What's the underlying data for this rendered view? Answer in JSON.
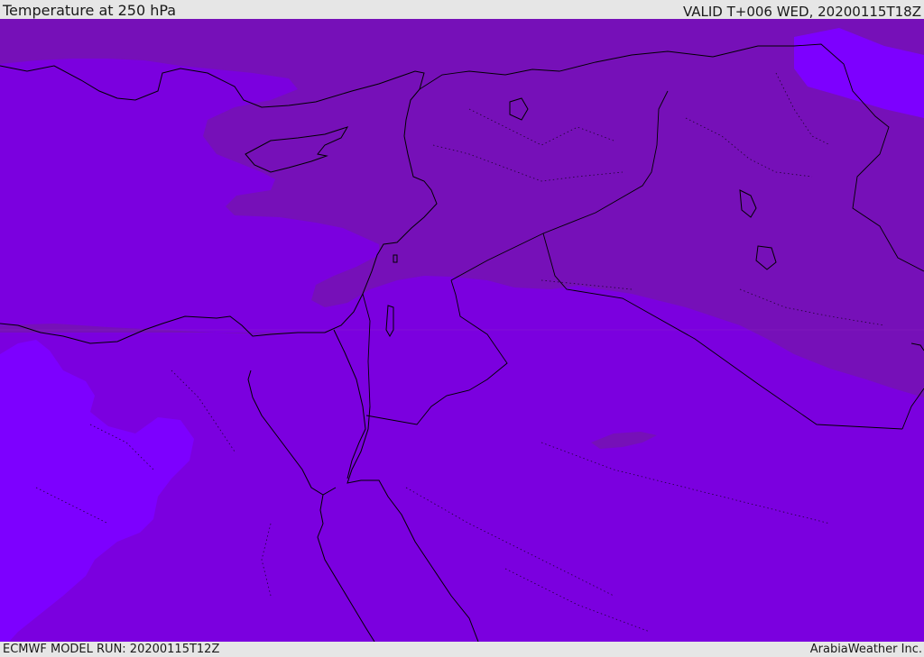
{
  "header": {
    "title": "Temperature at 250 hPa",
    "valid": "VALID T+006 WED, 20200115T18Z"
  },
  "footer": {
    "model_run": "ECMWF MODEL RUN: 20200115T12Z",
    "credit": "ArabiaWeather Inc."
  },
  "map": {
    "colors": {
      "band_warmest": "#7610b8",
      "band_warm": "#7b00df",
      "band_cold": "#7d00ff",
      "border": "#000000"
    }
  }
}
